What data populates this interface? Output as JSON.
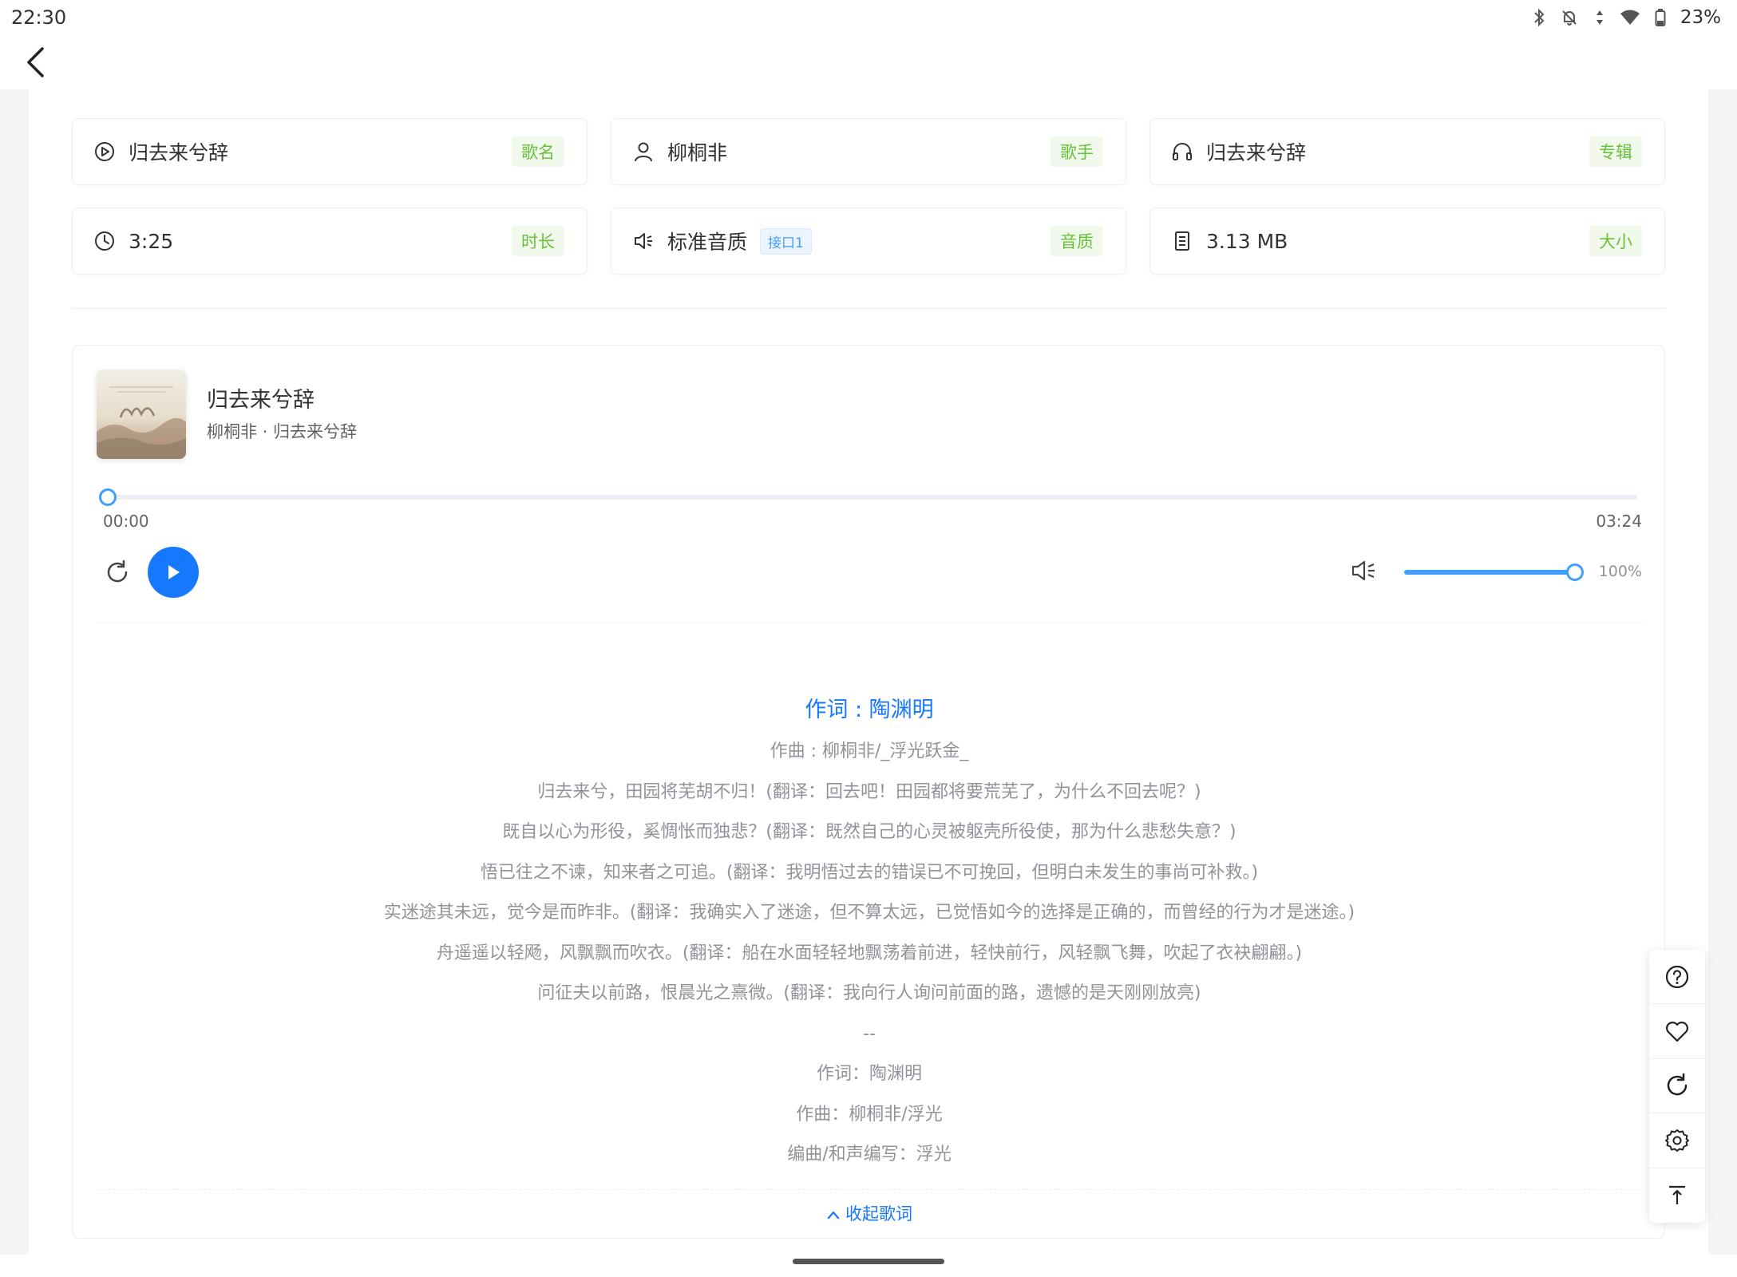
{
  "status_bar": {
    "time": "22:30",
    "battery": "23%",
    "icons": [
      "bluetooth-icon",
      "mute-icon",
      "data-icon",
      "wifi-icon",
      "battery-icon"
    ]
  },
  "top_bar": {
    "back_icon": "back-arrow-icon"
  },
  "info": {
    "song": {
      "value": "归去来兮辞",
      "tag": "歌名",
      "icon": "play-circle-icon"
    },
    "artist": {
      "value": "柳桐非",
      "tag": "歌手",
      "icon": "user-icon"
    },
    "album": {
      "value": "归去来兮辞",
      "tag": "专辑",
      "icon": "headphones-icon"
    },
    "duration": {
      "value": "3:25",
      "tag": "时长",
      "icon": "clock-icon"
    },
    "quality": {
      "value": "标准音质",
      "api_tag": "接口1",
      "tag": "音质",
      "icon": "speaker-icon"
    },
    "size": {
      "value": "3.13 MB",
      "tag": "大小",
      "icon": "file-icon"
    }
  },
  "player": {
    "title": "归去来兮辞",
    "subtitle": "柳桐非 · 归去来兮辞",
    "current_time": "00:00",
    "total_time": "03:24",
    "progress": 0,
    "volume": 1.0,
    "volume_label": "100%",
    "accent": "#1677ff"
  },
  "lyrics": {
    "active": "作词 : 陶渊明",
    "lines": [
      "作曲 : 柳桐非/_浮光跃金_",
      "归去来兮，田园将芜胡不归！(翻译：回去吧！田园都将要荒芜了，为什么不回去呢？)",
      "既自以心为形役，奚惆怅而独悲？(翻译：既然自己的心灵被躯壳所役使，那为什么悲愁失意？)",
      "悟已往之不谏，知来者之可追。(翻译：我明悟过去的错误已不可挽回，但明白未发生的事尚可补救。)",
      "实迷途其未远，觉今是而昨非。(翻译：我确实入了迷途，但不算太远，已觉悟如今的选择是正确的，而曾经的行为才是迷途。)",
      "舟遥遥以轻飏，风飘飘而吹衣。(翻译：船在水面轻轻地飘荡着前进，轻快前行，风轻飘飞舞，吹起了衣袂翩翩。)",
      "问征夫以前路，恨晨光之熹微。(翻译：我向行人询问前面的路，遗憾的是天刚刚放亮)",
      "--",
      "作词：陶渊明",
      "作曲：柳桐非/浮光",
      "编曲/和声编写：浮光"
    ],
    "collapse_label": "收起歌词"
  },
  "float_tools": [
    "help-icon",
    "heart-icon",
    "refresh-icon",
    "settings-icon",
    "back-to-top-icon"
  ]
}
